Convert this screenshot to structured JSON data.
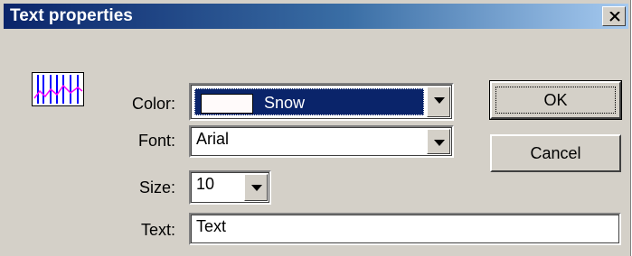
{
  "window": {
    "title": "Text properties",
    "close_icon": "close-icon"
  },
  "icon": {
    "name": "chart-icon"
  },
  "form": {
    "color_label": "Color:",
    "color_value": "Snow",
    "color_hex": "#fffafa",
    "font_label": "Font:",
    "font_value": "Arial",
    "size_label": "Size:",
    "size_value": "10",
    "text_label": "Text:",
    "text_value": "Text"
  },
  "buttons": {
    "ok": "OK",
    "cancel": "Cancel"
  },
  "colors": {
    "dialog_bg": "#d4d0c8",
    "titlebar_start": "#0a246a",
    "titlebar_end": "#a6caf0",
    "selection": "#0a246a"
  }
}
